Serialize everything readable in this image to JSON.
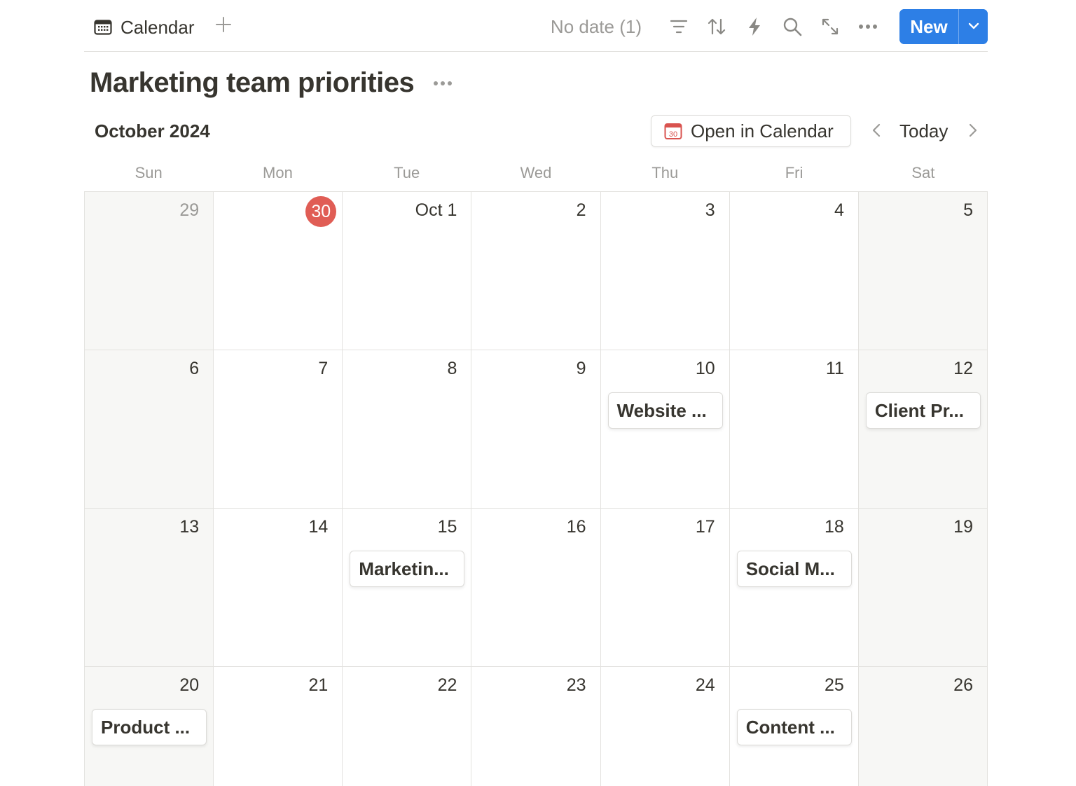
{
  "topbar": {
    "view_tab_label": "Calendar",
    "view_tab_icon": "calendar-icon",
    "no_date_label": "No date (1)",
    "tools": [
      "filter-icon",
      "sort-icon",
      "automation-bolt-icon",
      "search-icon",
      "expand-icon",
      "more-icon"
    ],
    "new_label": "New",
    "accent_color": "#2d7fe6"
  },
  "page": {
    "title": "Marketing team priorities"
  },
  "calendar": {
    "month_label": "October 2024",
    "open_in_calendar_label": "Open in Calendar",
    "open_in_calendar_icon_text": "30",
    "today_label": "Today",
    "weekdays": [
      "Sun",
      "Mon",
      "Tue",
      "Wed",
      "Thu",
      "Fri",
      "Sat"
    ],
    "today_color": "#e05d55",
    "weeks": [
      [
        {
          "label": "29",
          "muted": true
        },
        {
          "label": "30",
          "today": true
        },
        {
          "label": "Oct 1"
        },
        {
          "label": "2"
        },
        {
          "label": "3"
        },
        {
          "label": "4"
        },
        {
          "label": "5"
        }
      ],
      [
        {
          "label": "6"
        },
        {
          "label": "7"
        },
        {
          "label": "8"
        },
        {
          "label": "9"
        },
        {
          "label": "10",
          "event": "Website ..."
        },
        {
          "label": "11"
        },
        {
          "label": "12",
          "event": "Client Pr..."
        }
      ],
      [
        {
          "label": "13"
        },
        {
          "label": "14"
        },
        {
          "label": "15",
          "event": "Marketin..."
        },
        {
          "label": "16"
        },
        {
          "label": "17"
        },
        {
          "label": "18",
          "event": "Social M..."
        },
        {
          "label": "19"
        }
      ],
      [
        {
          "label": "20",
          "event": "Product ..."
        },
        {
          "label": "21"
        },
        {
          "label": "22"
        },
        {
          "label": "23"
        },
        {
          "label": "24"
        },
        {
          "label": "25",
          "event": "Content ..."
        },
        {
          "label": "26"
        }
      ]
    ]
  }
}
